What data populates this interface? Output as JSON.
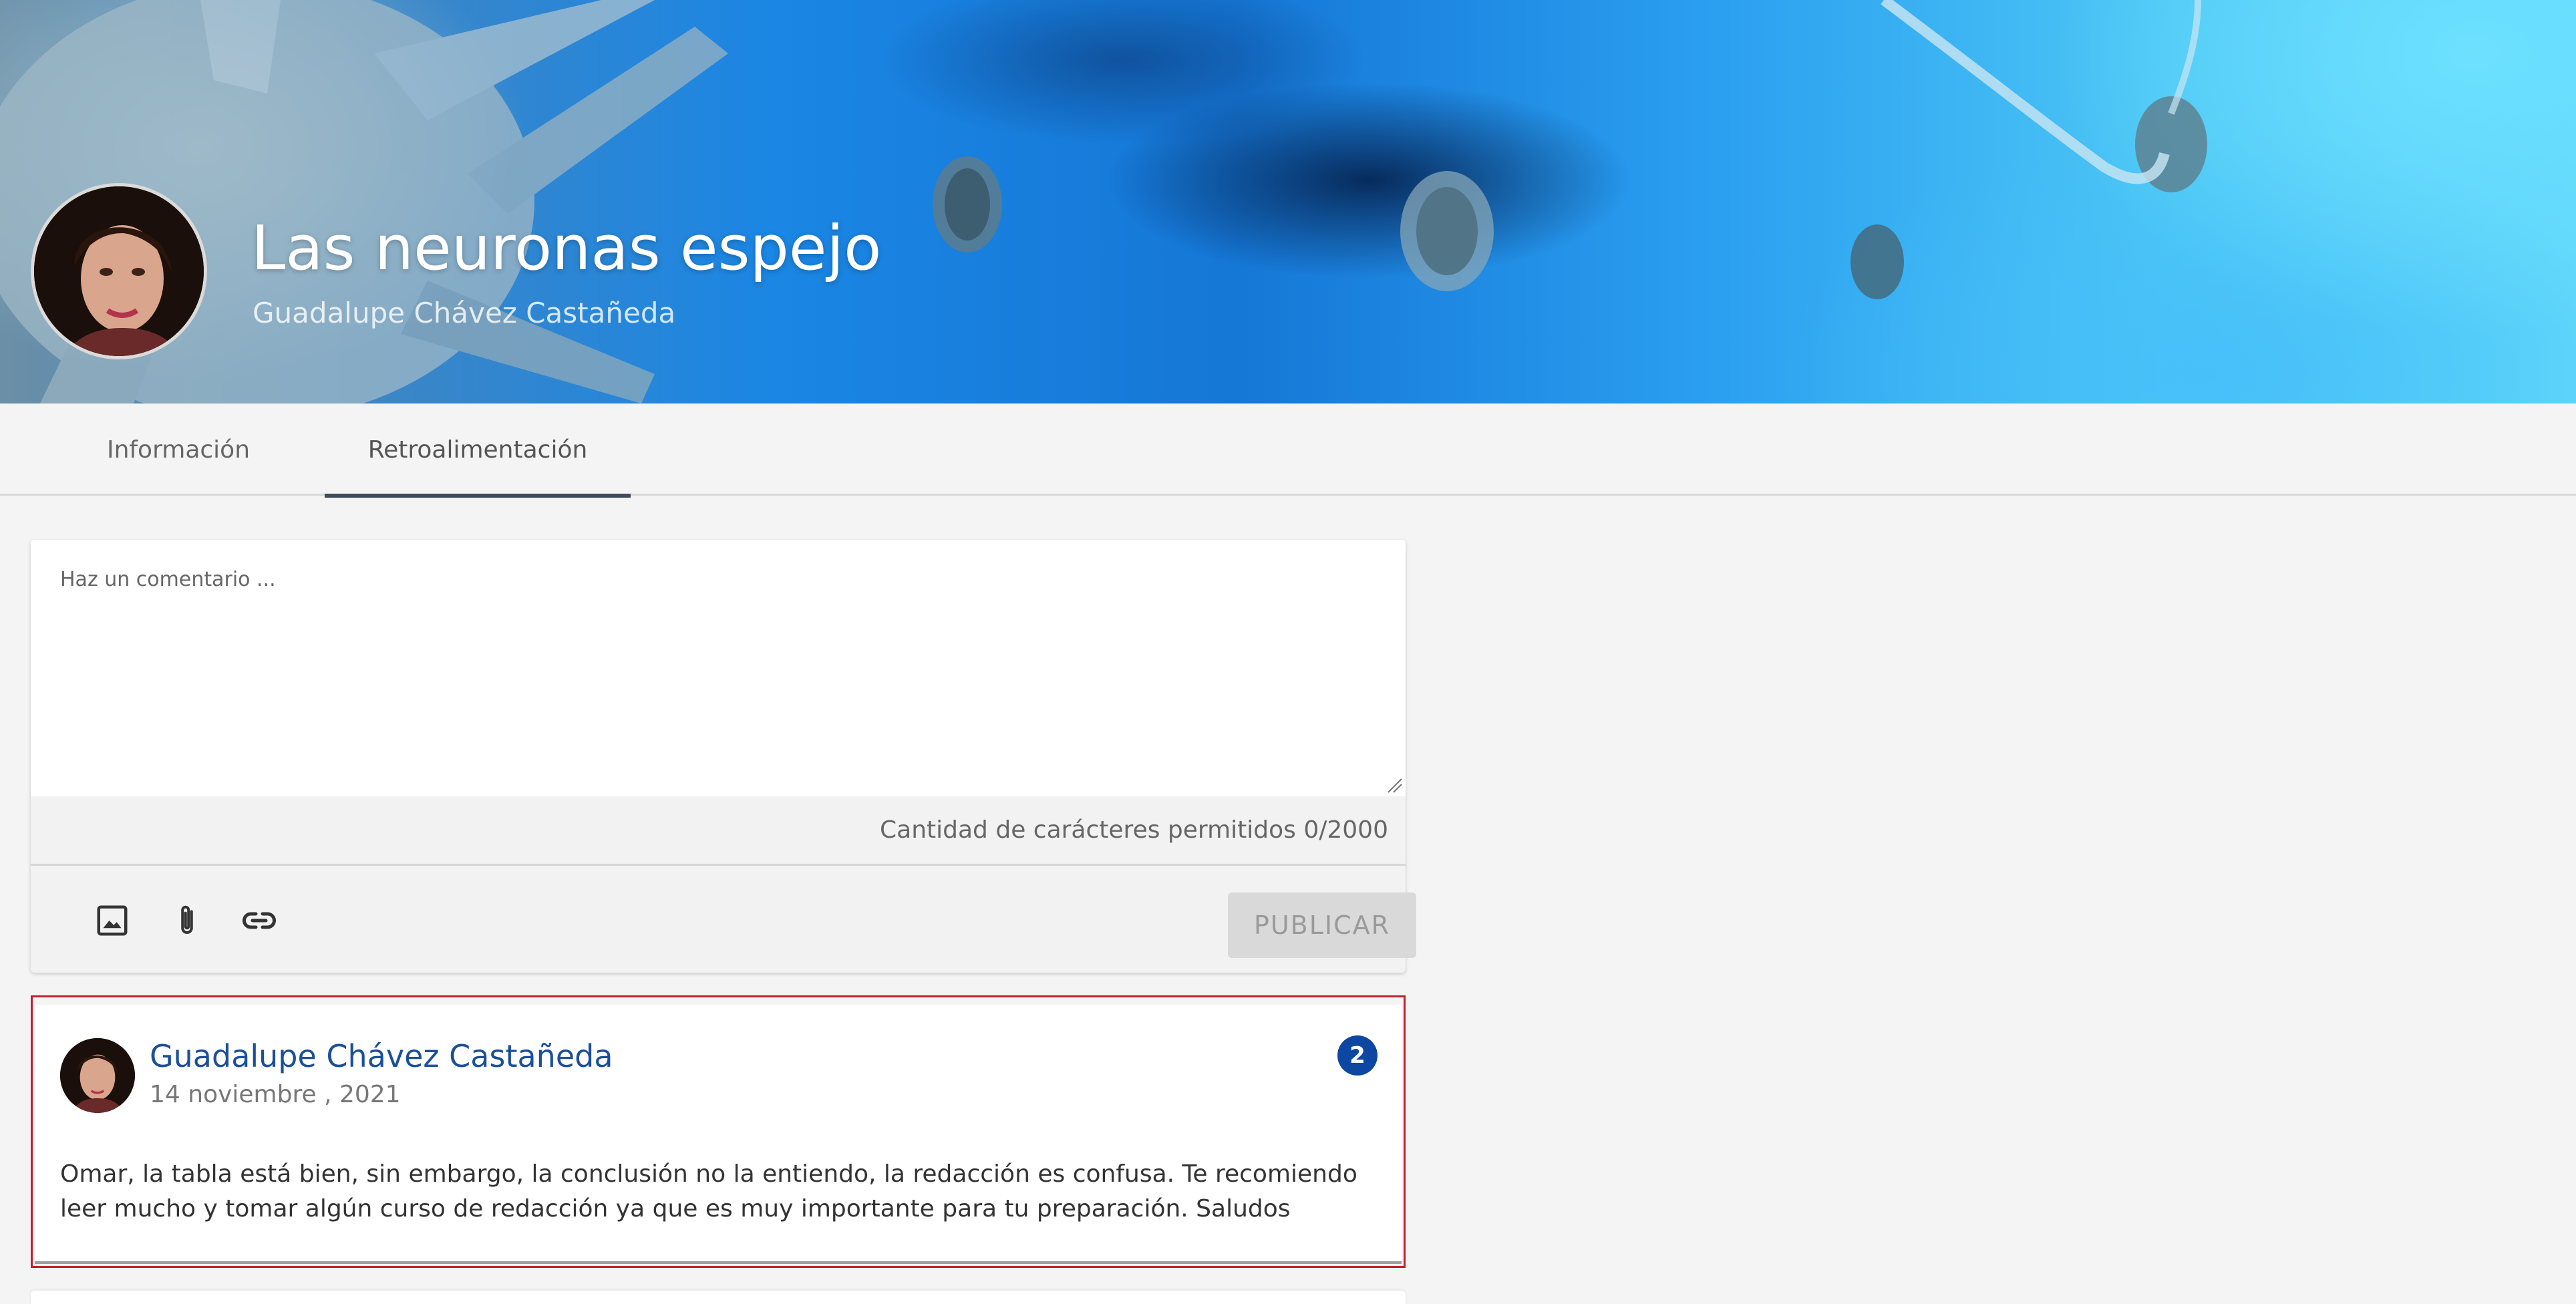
{
  "banner": {
    "title": "Las neuronas espejo",
    "subtitle": "Guadalupe Chávez Castañeda",
    "avatar_alt": "Guadalupe Chávez Castañeda"
  },
  "tabs": [
    {
      "label": "Información",
      "active": false
    },
    {
      "label": "Retroalimentación",
      "active": true
    }
  ],
  "composer": {
    "placeholder": "Haz un comentario ...",
    "value": "",
    "counter_text": "Cantidad de carácteres permitidos 0/2000",
    "tools": [
      {
        "icon": "image-icon"
      },
      {
        "icon": "attachment-icon"
      },
      {
        "icon": "link-icon"
      }
    ],
    "publish_label": "PUBLICAR"
  },
  "comments": [
    {
      "author": "Guadalupe Chávez Castañeda",
      "date": "14 noviembre , 2021",
      "badge": "2",
      "body": "Omar, la tabla está bien, sin embargo, la conclusión no la entiendo, la redacción es confusa. Te recomiendo leer mucho y tomar algún curso de redacción ya que es muy importante para tu preparación. Saludos"
    }
  ],
  "colors": {
    "accent": "#1c4f9a",
    "badge": "#0d47a1",
    "highlight_outline": "#c2202d",
    "tab_underline": "#3f4a5a"
  }
}
